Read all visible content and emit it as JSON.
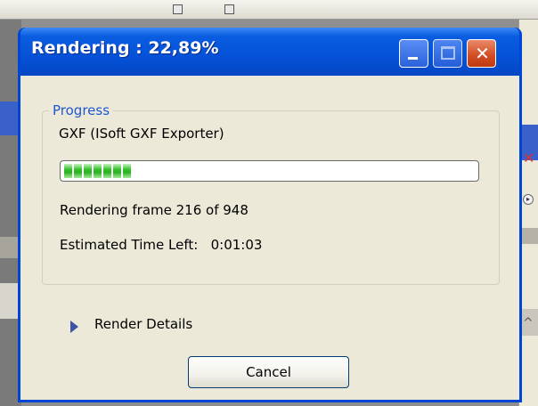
{
  "window": {
    "title": "Rendering : 22,89%",
    "minimize_icon": "minimize-icon",
    "maximize_icon": "maximize-icon",
    "close_icon": "close-icon",
    "close_glyph": "✕"
  },
  "progress_group": {
    "title": "Progress",
    "exporter_label": "GXF (ISoft GXF Exporter)",
    "progress_percent": 22.89,
    "filled_blocks": 7,
    "frame_text": "Rendering frame 216 of 948",
    "eta_text": "Estimated Time Left:   0:01:03"
  },
  "details": {
    "icon": "triangle-right-icon",
    "label": "Render Details"
  },
  "actions": {
    "cancel_label": "Cancel"
  },
  "colors": {
    "titlebar": "#0553d9",
    "group_title": "#1f57d0",
    "progress_fill": "#32c12a",
    "client_bg": "#ece9d8"
  }
}
